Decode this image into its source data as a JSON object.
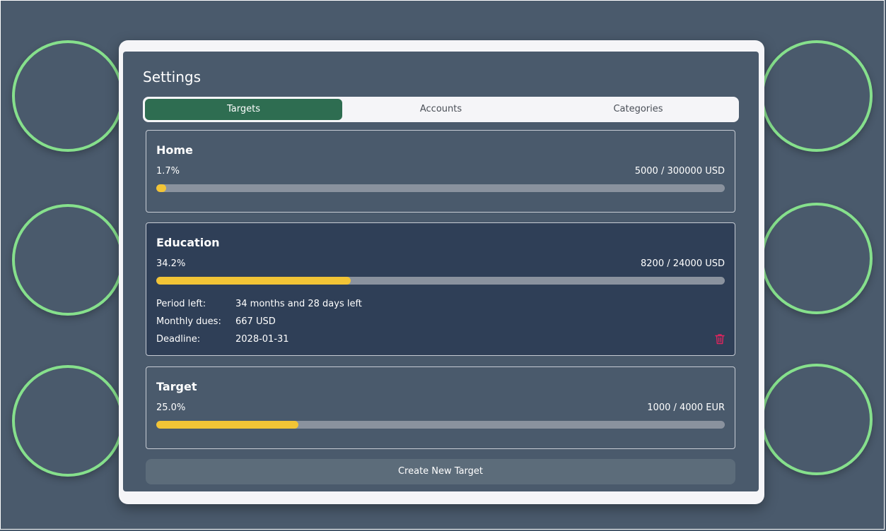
{
  "settings": {
    "title": "Settings",
    "tabs": [
      {
        "label": "Targets",
        "active": true
      },
      {
        "label": "Accounts",
        "active": false
      },
      {
        "label": "Categories",
        "active": false
      }
    ],
    "targets": [
      {
        "name": "Home",
        "percent_label": "1.7%",
        "amount_label": "5000 / 300000 USD",
        "progress": 0.017
      },
      {
        "name": "Education",
        "percent_label": "34.2%",
        "amount_label": "8200 / 24000 USD",
        "progress": 0.342,
        "expanded": true,
        "details": {
          "period_left_label": "Period left:",
          "period_left_value": "34 months and 28 days left",
          "monthly_dues_label": "Monthly dues:",
          "monthly_dues_value": "667 USD",
          "deadline_label": "Deadline:",
          "deadline_value": "2028-01-31"
        },
        "delete_icon": "trash-icon"
      },
      {
        "name": "Target",
        "percent_label": "25.0%",
        "amount_label": "1000 / 4000 EUR",
        "progress": 0.25
      }
    ],
    "create_button_label": "Create New Target"
  },
  "colors": {
    "background": "#4a5a6c",
    "active_tab": "#2e6d51",
    "progress_fill": "#f2c436",
    "progress_track": "#8a929e",
    "ring": "#86e08c",
    "delete_icon": "#e0245e",
    "expanded_card": "#2f3f57"
  }
}
